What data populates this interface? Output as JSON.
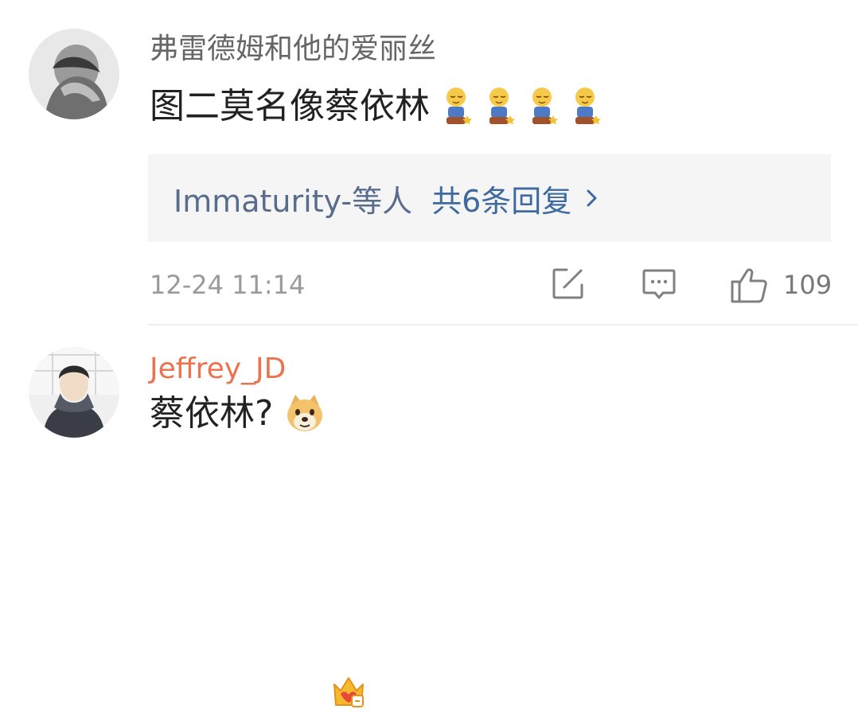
{
  "comments": [
    {
      "username": "弗雷德姆和他的爱丽丝",
      "text": "图二莫名像蔡依林",
      "emojis": [
        "sleepy-kneeling-emoji",
        "sleepy-kneeling-emoji",
        "sleepy-kneeling-emoji",
        "sleepy-kneeling-emoji"
      ],
      "replies": {
        "names": "Immaturity-等人",
        "count_label": "共6条回复"
      },
      "timestamp": "12-24 11:14",
      "likes": "109"
    },
    {
      "username": "Jeffrey_JD",
      "text": "蔡依林?",
      "emojis": [
        "doge-emoji"
      ],
      "badge": "crown-badge-icon"
    }
  ],
  "colors": {
    "username_default": "#666666",
    "username_vip": "#eb7350",
    "link": "#3f6aa0",
    "reply_bg": "#f5f5f5",
    "meta": "#9a9a9a"
  }
}
